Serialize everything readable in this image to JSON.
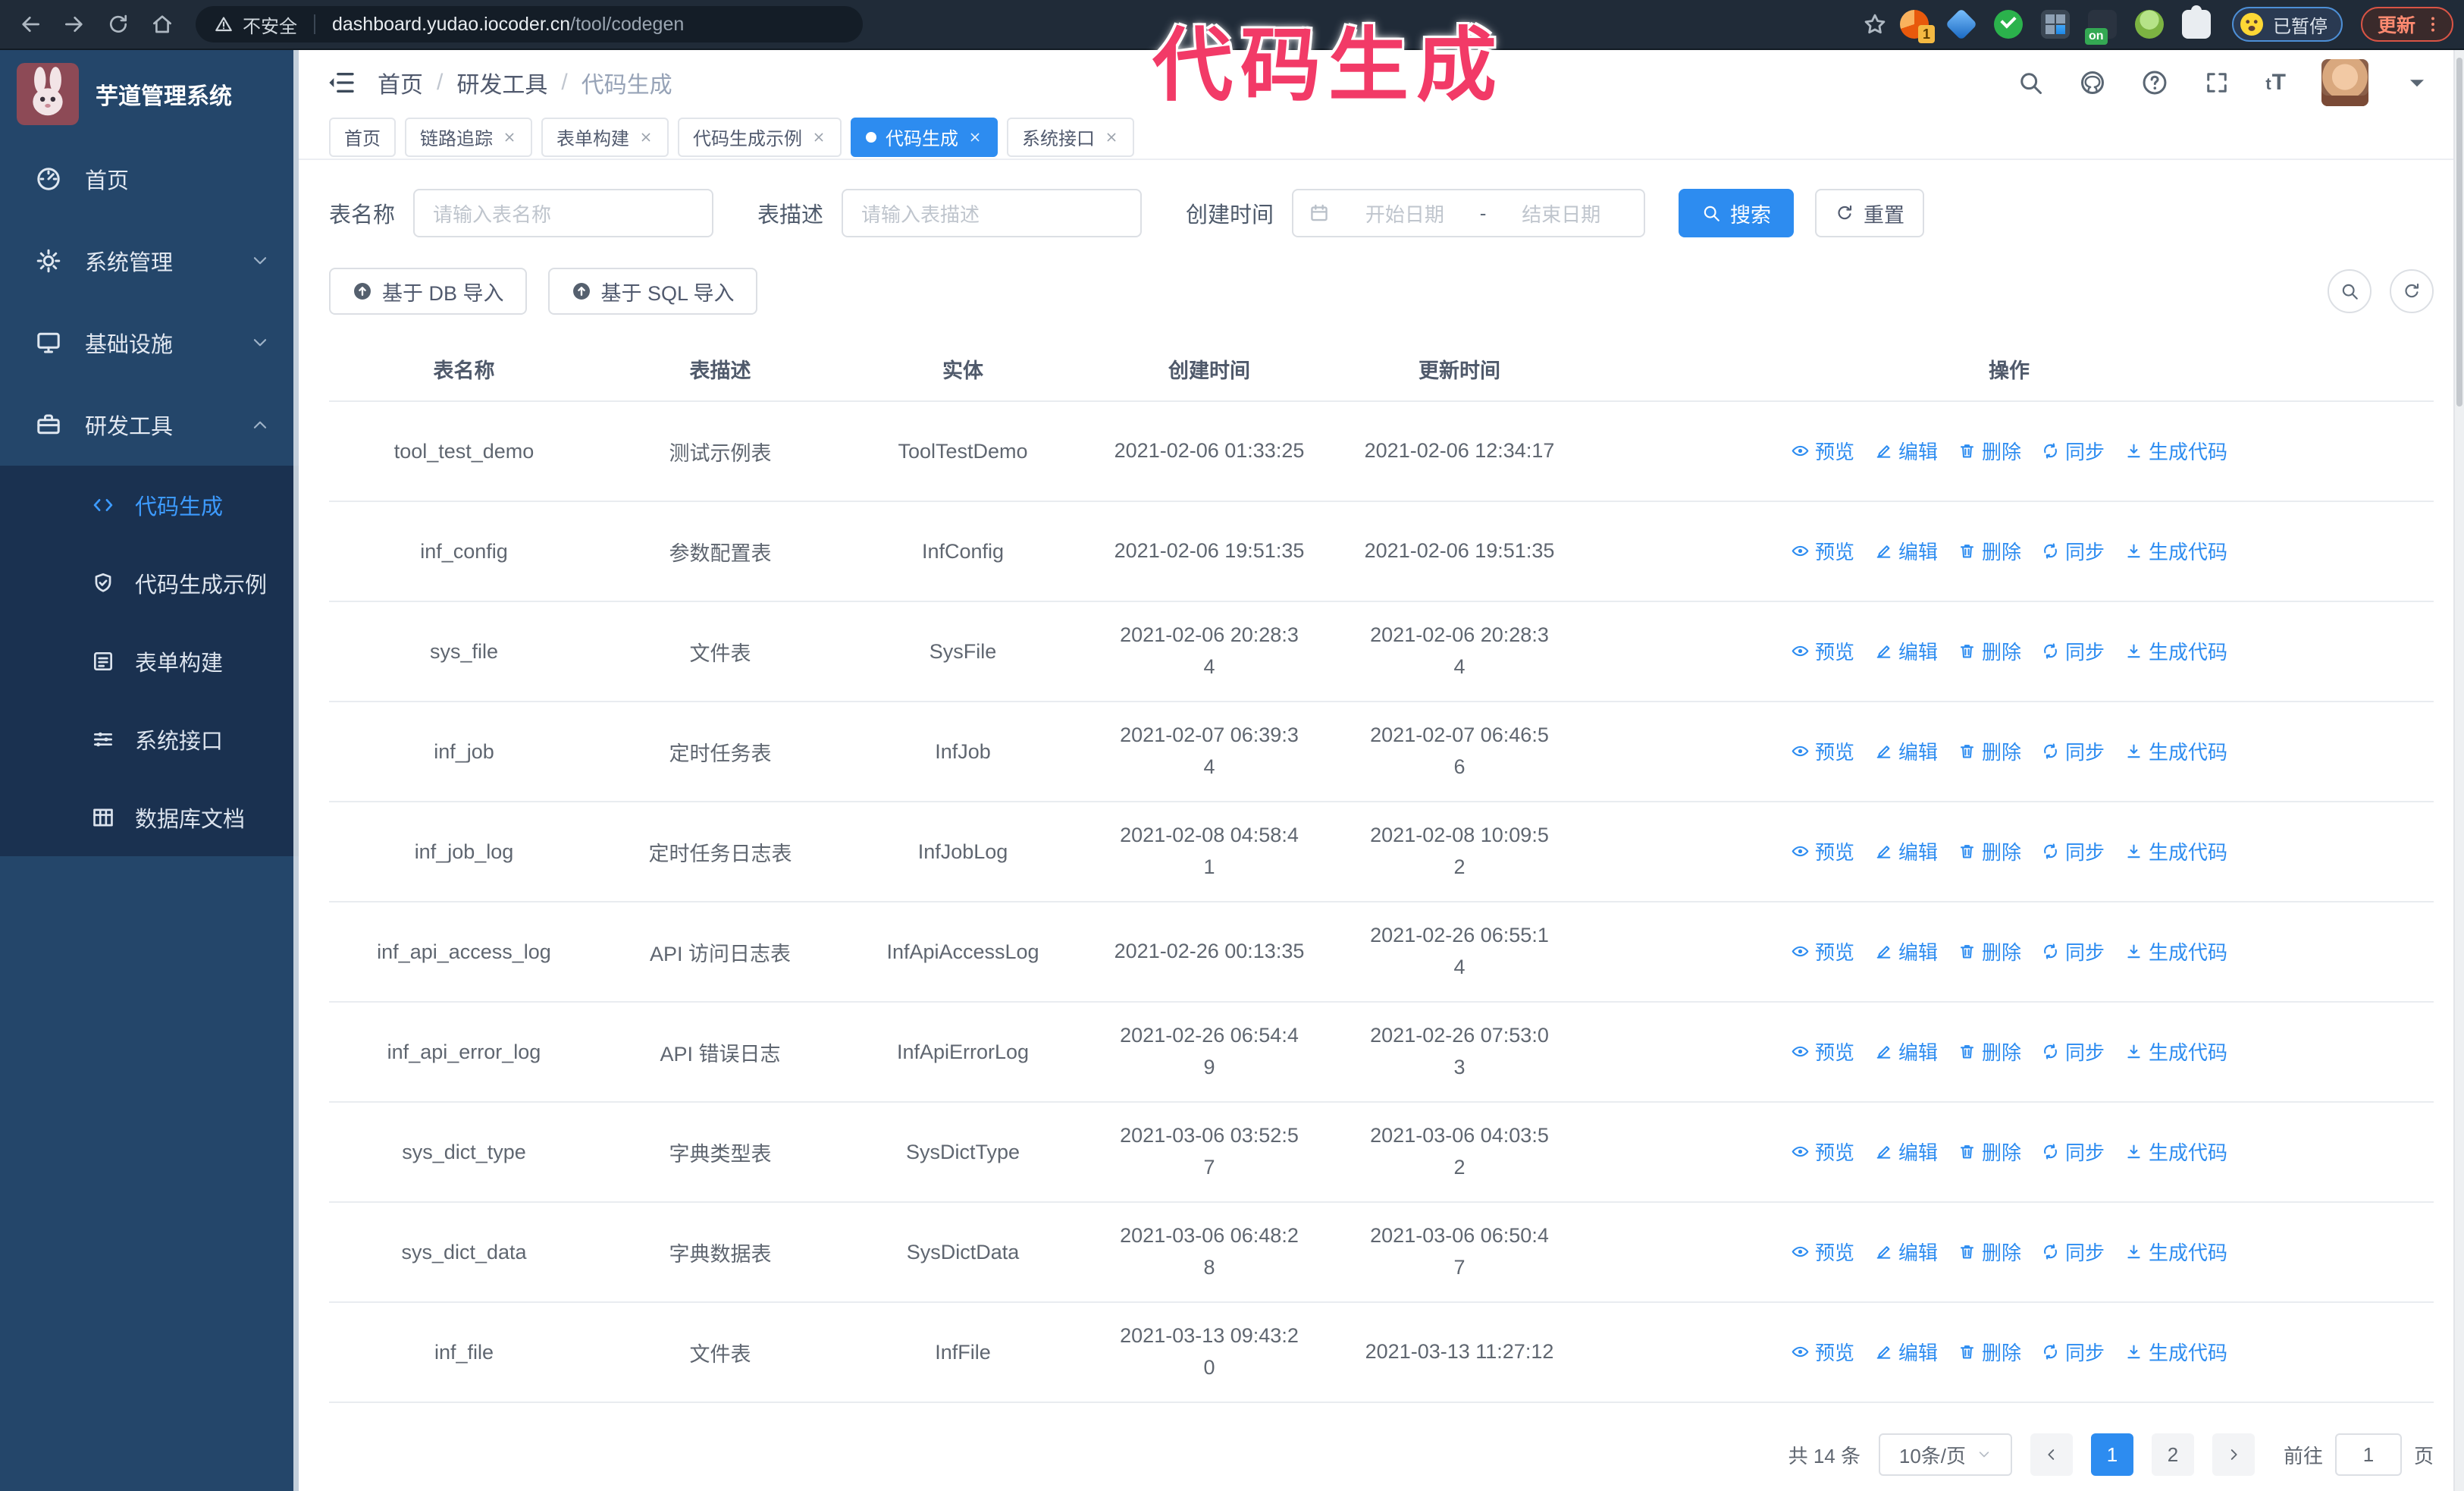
{
  "theme": {
    "accent": "#2d8cf0",
    "annotation": "#f23a67",
    "sidebar_bg": "#24466a",
    "sidebar_submenu_bg": "#1a3150",
    "active_menu": "#3d9bff",
    "update_red": "#d95445"
  },
  "browser": {
    "security_label": "不安全",
    "url_domain": "dashboard.yudao.iocoder.cn",
    "url_path": "/tool/codegen",
    "ext_badge_count": "1",
    "ext_on_label": "on",
    "paused_label": "已暂停",
    "update_label": "更新"
  },
  "annotation": {
    "text": "代码生成"
  },
  "sidebar": {
    "title": "芋道管理系统",
    "items": [
      {
        "id": "home",
        "icon": "home",
        "label": "首页"
      },
      {
        "id": "system-management",
        "icon": "gear",
        "label": "系统管理",
        "arrow": "down"
      },
      {
        "id": "infrastructure",
        "icon": "monitor",
        "label": "基础设施",
        "arrow": "down"
      },
      {
        "id": "dev-tools",
        "icon": "toolbox",
        "label": "研发工具",
        "arrow": "up",
        "expanded": true
      }
    ],
    "submenu": [
      {
        "id": "codegen",
        "icon": "code",
        "label": "代码生成",
        "active": true
      },
      {
        "id": "codegen-example",
        "icon": "shield-check",
        "label": "代码生成示例"
      },
      {
        "id": "form-builder",
        "icon": "form",
        "label": "表单构建"
      },
      {
        "id": "system-api",
        "icon": "sliders",
        "label": "系统接口"
      },
      {
        "id": "db-doc",
        "icon": "table-grid",
        "label": "数据库文档"
      }
    ]
  },
  "header": {
    "breadcrumb": [
      "首页",
      "研发工具",
      "代码生成"
    ],
    "text_size_label": "tT"
  },
  "tabs": [
    {
      "label": "首页",
      "closable": false
    },
    {
      "label": "链路追踪",
      "closable": true
    },
    {
      "label": "表单构建",
      "closable": true
    },
    {
      "label": "代码生成示例",
      "closable": true
    },
    {
      "label": "代码生成",
      "closable": true,
      "active": true
    },
    {
      "label": "系统接口",
      "closable": true
    }
  ],
  "filters": {
    "table_name_label": "表名称",
    "table_name_placeholder": "请输入表名称",
    "table_desc_label": "表描述",
    "table_desc_placeholder": "请输入表描述",
    "create_time_label": "创建时间",
    "start_date_placeholder": "开始日期",
    "range_separator": "-",
    "end_date_placeholder": "结束日期",
    "search_label": "搜索",
    "reset_label": "重置"
  },
  "toolbar": {
    "import_db_label": "基于 DB 导入",
    "import_sql_label": "基于 SQL 导入"
  },
  "table": {
    "columns": [
      "表名称",
      "表描述",
      "实体",
      "创建时间",
      "更新时间",
      "操作"
    ],
    "ops": [
      {
        "id": "preview",
        "icon": "eye",
        "label": "预览"
      },
      {
        "id": "edit",
        "icon": "edit",
        "label": "编辑"
      },
      {
        "id": "delete",
        "icon": "trash",
        "label": "删除"
      },
      {
        "id": "sync",
        "icon": "sync",
        "label": "同步"
      },
      {
        "id": "generate-code",
        "icon": "download",
        "label": "生成代码"
      }
    ],
    "rows": [
      {
        "name": "tool_test_demo",
        "desc": "测试示例表",
        "entity": "ToolTestDemo",
        "created": "2021-02-06 01:33:25",
        "updated": "2021-02-06 12:34:17"
      },
      {
        "name": "inf_config",
        "desc": "参数配置表",
        "entity": "InfConfig",
        "created": "2021-02-06 19:51:35",
        "updated": "2021-02-06 19:51:35"
      },
      {
        "name": "sys_file",
        "desc": "文件表",
        "entity": "SysFile",
        "created": "2021-02-06 20:28:3\n4",
        "updated": "2021-02-06 20:28:3\n4"
      },
      {
        "name": "inf_job",
        "desc": "定时任务表",
        "entity": "InfJob",
        "created": "2021-02-07 06:39:3\n4",
        "updated": "2021-02-07 06:46:5\n6"
      },
      {
        "name": "inf_job_log",
        "desc": "定时任务日志表",
        "entity": "InfJobLog",
        "created": "2021-02-08 04:58:4\n1",
        "updated": "2021-02-08 10:09:5\n2"
      },
      {
        "name": "inf_api_access_log",
        "desc": "API 访问日志表",
        "entity": "InfApiAccessLog",
        "created": "2021-02-26 00:13:35",
        "updated": "2021-02-26 06:55:1\n4"
      },
      {
        "name": "inf_api_error_log",
        "desc": "API 错误日志",
        "entity": "InfApiErrorLog",
        "created": "2021-02-26 06:54:4\n9",
        "updated": "2021-02-26 07:53:0\n3"
      },
      {
        "name": "sys_dict_type",
        "desc": "字典类型表",
        "entity": "SysDictType",
        "created": "2021-03-06 03:52:5\n7",
        "updated": "2021-03-06 04:03:5\n2"
      },
      {
        "name": "sys_dict_data",
        "desc": "字典数据表",
        "entity": "SysDictData",
        "created": "2021-03-06 06:48:2\n8",
        "updated": "2021-03-06 06:50:4\n7"
      },
      {
        "name": "inf_file",
        "desc": "文件表",
        "entity": "InfFile",
        "created": "2021-03-13 09:43:2\n0",
        "updated": "2021-03-13 11:27:12"
      }
    ]
  },
  "pagination": {
    "total": "共 14 条",
    "page_size": "10条/页",
    "pages": [
      "1",
      "2"
    ],
    "active_page": "1",
    "goto_label": "前往",
    "goto_value": "1",
    "unit_label": "页"
  }
}
